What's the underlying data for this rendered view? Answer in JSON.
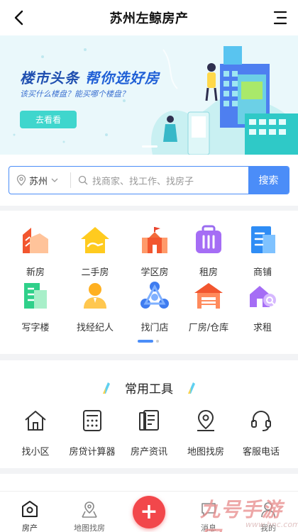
{
  "header": {
    "title": "苏州左鲸房产",
    "back_icon": "chevron-left-icon",
    "menu_icon": "menu-icon"
  },
  "banner": {
    "headline_a": "楼市头条",
    "headline_b": "帮你选好房",
    "subtitle": "该买什么楼盘？能买哪个楼盘？",
    "cta": "去看看",
    "colors": {
      "bg": "#eaf8fb",
      "cta": "#3fd6cd",
      "headline": "#1f5fd6"
    }
  },
  "search": {
    "city": "苏州",
    "placeholder": "找商家、找工作、找房子",
    "button": "搜索",
    "accent": "#4b8df8"
  },
  "categories": [
    {
      "label": "新房",
      "icon": "new-house-icon"
    },
    {
      "label": "二手房",
      "icon": "second-hand-house-icon"
    },
    {
      "label": "学区房",
      "icon": "school-district-icon"
    },
    {
      "label": "租房",
      "icon": "rent-icon"
    },
    {
      "label": "商铺",
      "icon": "shop-icon"
    },
    {
      "label": "写字楼",
      "icon": "office-building-icon"
    },
    {
      "label": "找经纪人",
      "icon": "agent-icon"
    },
    {
      "label": "找门店",
      "icon": "store-icon"
    },
    {
      "label": "厂房/仓库",
      "icon": "warehouse-icon"
    },
    {
      "label": "求租",
      "icon": "seek-rent-icon"
    }
  ],
  "tools": {
    "title": "常用工具",
    "items": [
      {
        "label": "找小区",
        "icon": "home-icon"
      },
      {
        "label": "房贷计算器",
        "icon": "calculator-icon"
      },
      {
        "label": "房产资讯",
        "icon": "news-icon"
      },
      {
        "label": "地图找房",
        "icon": "map-pin-icon"
      },
      {
        "label": "客服电话",
        "icon": "headset-icon"
      }
    ]
  },
  "nav": {
    "items": [
      {
        "label": "房产",
        "icon": "house-icon"
      },
      {
        "label": "地图找房",
        "icon": "map-icon"
      },
      {
        "label": "消息",
        "icon": "message-icon"
      },
      {
        "label": "我的",
        "icon": "user-icon"
      }
    ],
    "fab": "+",
    "fab_color": "#f2474b"
  },
  "watermark": {
    "brand": "九号手游网",
    "url": "www.hnc.com"
  }
}
